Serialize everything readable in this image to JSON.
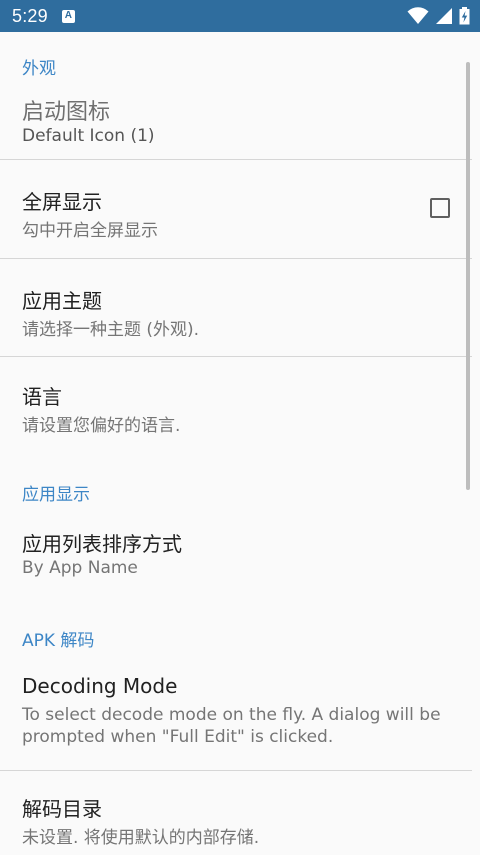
{
  "status_bar": {
    "time": "5:29",
    "notification_glyph": "A",
    "icons": [
      "wifi-icon",
      "cell-signal-icon",
      "battery-charging-icon"
    ]
  },
  "colors": {
    "status_bar_bg": "#2F6D9E",
    "section_header": "#3D86C6",
    "background": "#FAFAFA"
  },
  "sections": [
    {
      "header": "外观",
      "items": [
        {
          "title": "启动图标",
          "summary": "Default Icon (1)"
        },
        {
          "title": "全屏显示",
          "summary": "勾中开启全屏显示",
          "checkbox": false
        },
        {
          "title": "应用主题",
          "summary": "请选择一种主题 (外观)."
        },
        {
          "title": "语言",
          "summary": "请设置您偏好的语言."
        }
      ]
    },
    {
      "header": "应用显示",
      "items": [
        {
          "title": "应用列表排序方式",
          "summary": "By App Name"
        }
      ]
    },
    {
      "header": "APK 解码",
      "items": [
        {
          "title": "Decoding Mode",
          "summary": "To select decode mode on the fly. A dialog will be prompted when \"Full Edit\" is clicked."
        },
        {
          "title": "解码目录",
          "summary": "未设置. 将使用默认的内部存储."
        }
      ]
    }
  ]
}
